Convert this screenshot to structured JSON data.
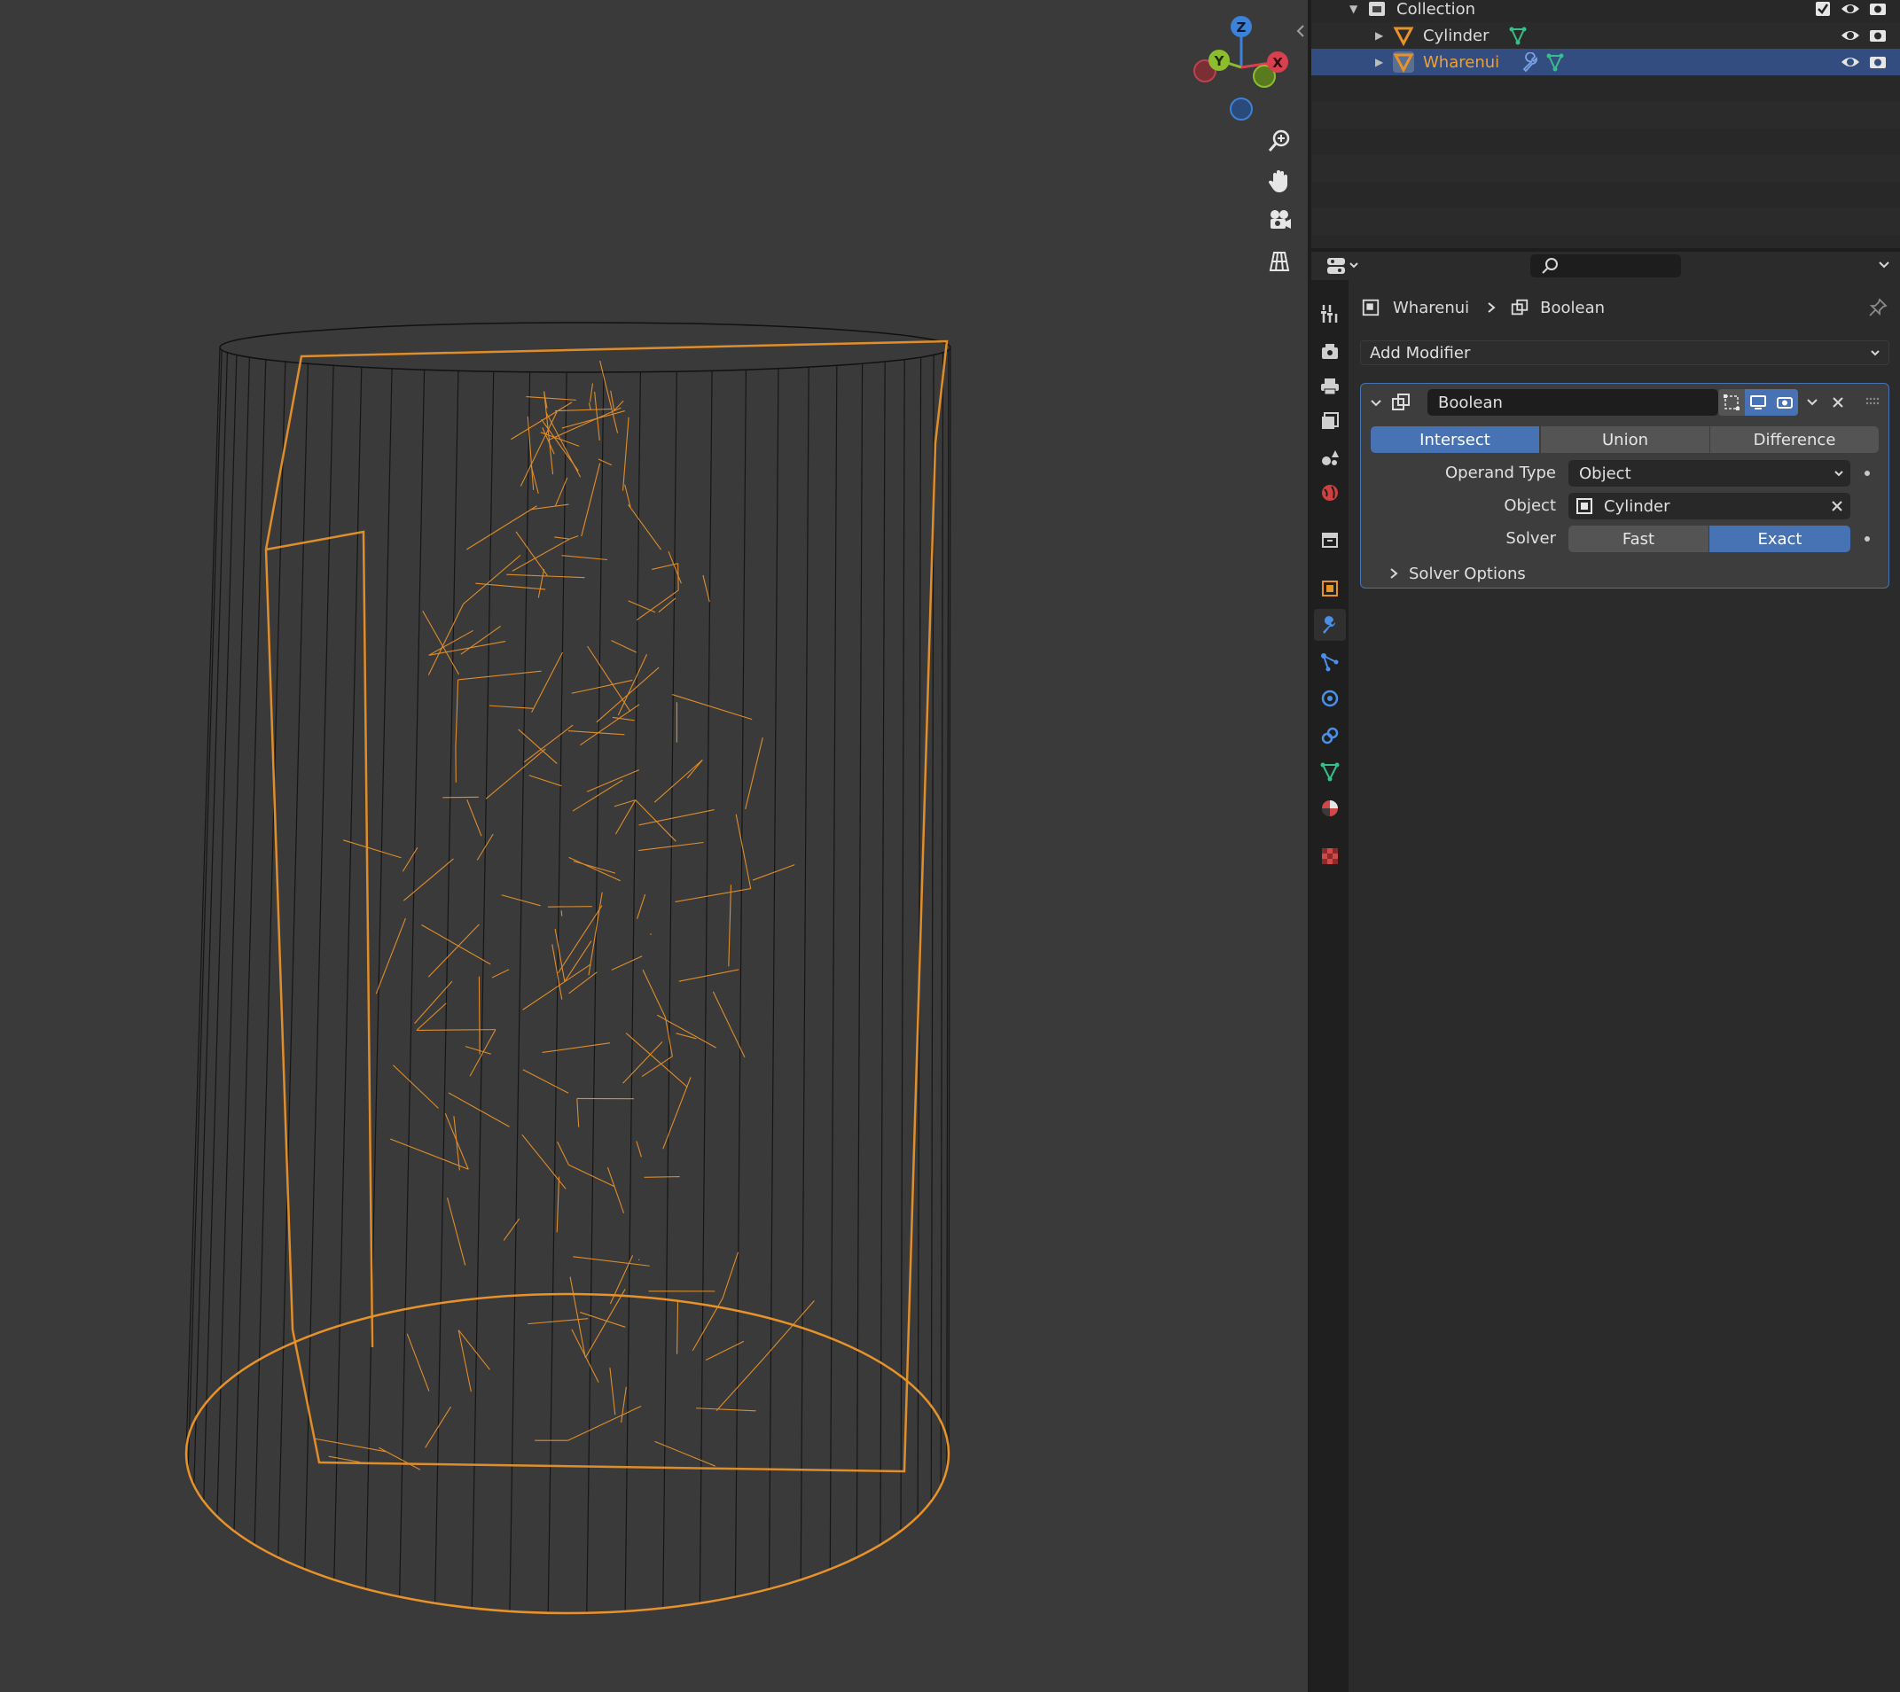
{
  "outliner": {
    "rows": [
      {
        "label": "Collection",
        "icon": "collection-icon"
      },
      {
        "label": "Cylinder",
        "icon": "mesh-object-icon"
      },
      {
        "label": "Wharenui",
        "icon": "mesh-object-icon",
        "selected": true
      }
    ]
  },
  "viewport": {
    "gizmo_axes": {
      "z": "Z",
      "y": "Y",
      "x": "X"
    },
    "tools": [
      "zoom-icon",
      "pan-hand-icon",
      "camera-icon",
      "grid-ortho-icon"
    ],
    "wire_color": "#e8922a"
  },
  "properties": {
    "breadcrumb": {
      "object": "Wharenui",
      "modifier": "Boolean"
    },
    "add_modifier": "Add Modifier",
    "modifier": {
      "name": "Boolean",
      "operations": [
        "Intersect",
        "Union",
        "Difference"
      ],
      "active_operation": "Intersect",
      "operand_type_label": "Operand Type",
      "operand_type_value": "Object",
      "object_label": "Object",
      "object_value": "Cylinder",
      "solver_label": "Solver",
      "solvers": [
        "Fast",
        "Exact"
      ],
      "active_solver": "Exact",
      "solver_options": "Solver Options"
    },
    "accent_color": "#4772b3"
  }
}
